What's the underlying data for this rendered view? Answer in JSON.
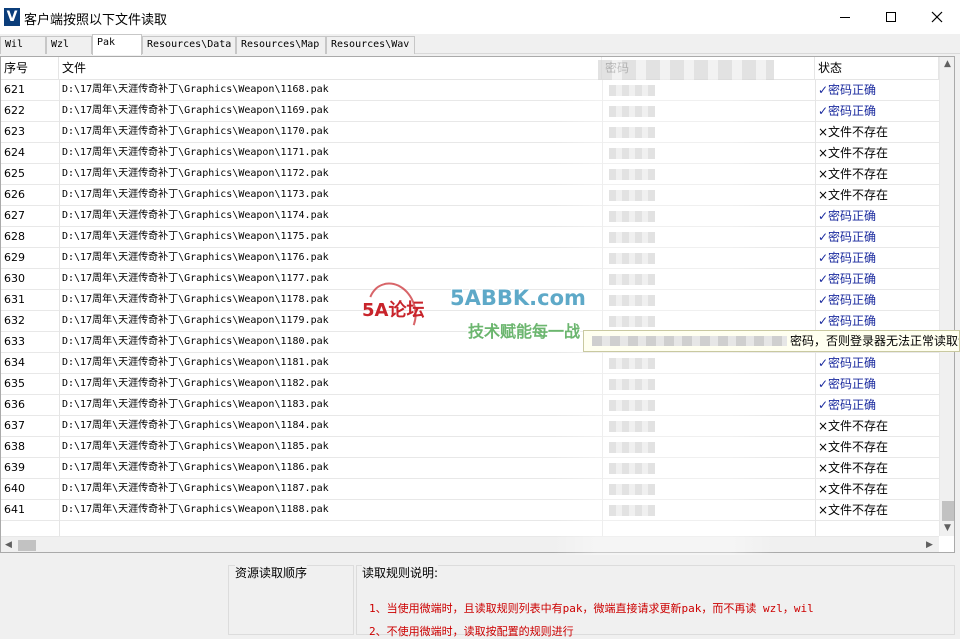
{
  "window": {
    "title": "客户端按照以下文件读取",
    "app_icon_letter": "V"
  },
  "tabs": [
    {
      "label": "Wil",
      "active": false
    },
    {
      "label": "Wzl",
      "active": false
    },
    {
      "label": "Pak",
      "active": true
    },
    {
      "label": "Resources\\Data",
      "active": false
    },
    {
      "label": "Resources\\Map",
      "active": false
    },
    {
      "label": "Resources\\Wav",
      "active": false
    }
  ],
  "table": {
    "headers": {
      "index": "序号",
      "file": "文件",
      "password": "密码",
      "status": "状态"
    },
    "status_colors": {
      "ok": "#1a2a9e",
      "bad": "#000000"
    },
    "rows": [
      {
        "index": "621",
        "file": "D:\\17周年\\天涯传奇补丁\\Graphics\\Weapon\\1168.pak",
        "status": "✓密码正确",
        "ok": true
      },
      {
        "index": "622",
        "file": "D:\\17周年\\天涯传奇补丁\\Graphics\\Weapon\\1169.pak",
        "status": "✓密码正确",
        "ok": true
      },
      {
        "index": "623",
        "file": "D:\\17周年\\天涯传奇补丁\\Graphics\\Weapon\\1170.pak",
        "status": "×文件不存在",
        "ok": false
      },
      {
        "index": "624",
        "file": "D:\\17周年\\天涯传奇补丁\\Graphics\\Weapon\\1171.pak",
        "status": "×文件不存在",
        "ok": false
      },
      {
        "index": "625",
        "file": "D:\\17周年\\天涯传奇补丁\\Graphics\\Weapon\\1172.pak",
        "status": "×文件不存在",
        "ok": false
      },
      {
        "index": "626",
        "file": "D:\\17周年\\天涯传奇补丁\\Graphics\\Weapon\\1173.pak",
        "status": "×文件不存在",
        "ok": false
      },
      {
        "index": "627",
        "file": "D:\\17周年\\天涯传奇补丁\\Graphics\\Weapon\\1174.pak",
        "status": "✓密码正确",
        "ok": true
      },
      {
        "index": "628",
        "file": "D:\\17周年\\天涯传奇补丁\\Graphics\\Weapon\\1175.pak",
        "status": "✓密码正确",
        "ok": true
      },
      {
        "index": "629",
        "file": "D:\\17周年\\天涯传奇补丁\\Graphics\\Weapon\\1176.pak",
        "status": "✓密码正确",
        "ok": true
      },
      {
        "index": "630",
        "file": "D:\\17周年\\天涯传奇补丁\\Graphics\\Weapon\\1177.pak",
        "status": "✓密码正确",
        "ok": true
      },
      {
        "index": "631",
        "file": "D:\\17周年\\天涯传奇补丁\\Graphics\\Weapon\\1178.pak",
        "status": "✓密码正确",
        "ok": true
      },
      {
        "index": "632",
        "file": "D:\\17周年\\天涯传奇补丁\\Graphics\\Weapon\\1179.pak",
        "status": "✓密码正确",
        "ok": true
      },
      {
        "index": "633",
        "file": "D:\\17周年\\天涯传奇补丁\\Graphics\\Weapon\\1180.pak",
        "status": "",
        "ok": true
      },
      {
        "index": "634",
        "file": "D:\\17周年\\天涯传奇补丁\\Graphics\\Weapon\\1181.pak",
        "status": "✓密码正确",
        "ok": true
      },
      {
        "index": "635",
        "file": "D:\\17周年\\天涯传奇补丁\\Graphics\\Weapon\\1182.pak",
        "status": "✓密码正确",
        "ok": true
      },
      {
        "index": "636",
        "file": "D:\\17周年\\天涯传奇补丁\\Graphics\\Weapon\\1183.pak",
        "status": "✓密码正确",
        "ok": true
      },
      {
        "index": "637",
        "file": "D:\\17周年\\天涯传奇补丁\\Graphics\\Weapon\\1184.pak",
        "status": "×文件不存在",
        "ok": false
      },
      {
        "index": "638",
        "file": "D:\\17周年\\天涯传奇补丁\\Graphics\\Weapon\\1185.pak",
        "status": "×文件不存在",
        "ok": false
      },
      {
        "index": "639",
        "file": "D:\\17周年\\天涯传奇补丁\\Graphics\\Weapon\\1186.pak",
        "status": "×文件不存在",
        "ok": false
      },
      {
        "index": "640",
        "file": "D:\\17周年\\天涯传奇补丁\\Graphics\\Weapon\\1187.pak",
        "status": "×文件不存在",
        "ok": false
      },
      {
        "index": "641",
        "file": "D:\\17周年\\天涯传奇补丁\\Graphics\\Weapon\\1188.pak",
        "status": "×文件不存在",
        "ok": false
      }
    ]
  },
  "tooltip": {
    "text": "密码，否则登录器无法正常读取该Pa"
  },
  "bottom": {
    "resource_order_title": "资源读取顺序",
    "rules_title": "读取规则说明:",
    "rules": [
      "1、当使用微端时，且读取规则列表中有pak，微端直接请求更新pak，而不再读 wzl，wil",
      "2、不使用微端时，读取按配置的规则进行"
    ]
  },
  "watermark": {
    "logo": "5A论坛",
    "site": "5ABBK.com",
    "slogan": "技术赋能每一战"
  }
}
